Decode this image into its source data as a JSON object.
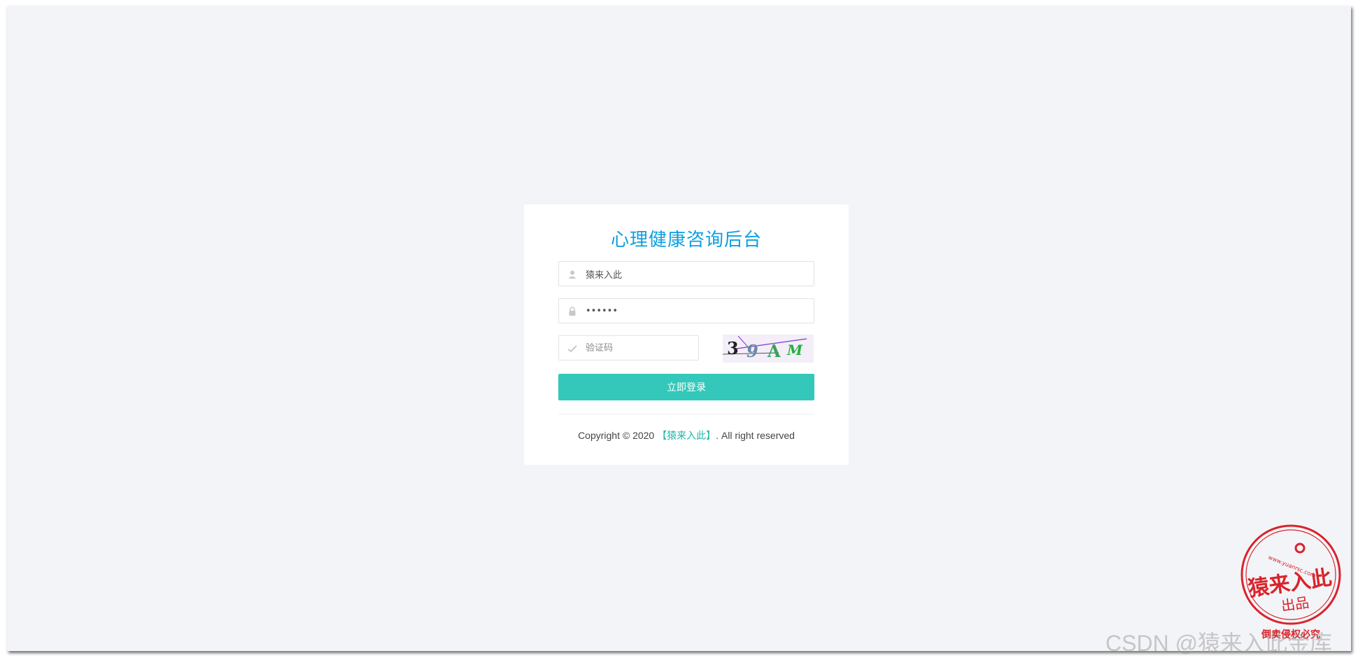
{
  "login": {
    "title": "心理健康咨询后台",
    "username_value": "猿来入此",
    "password_value": "••••••",
    "captcha_placeholder": "验证码",
    "captcha_chars": [
      "3",
      "9",
      "A",
      "M"
    ],
    "submit_label": "立即登录"
  },
  "footer": {
    "copyright_prefix": "Copyright © 2020 ",
    "brand_link": "【猿来入此】",
    "copyright_suffix": ". All right reserved"
  },
  "watermark": {
    "text": "CSDN @猿来入此金库"
  },
  "seal": {
    "main_text": "猿来入此",
    "sub_text": "出品",
    "url_text": "www.yuanrsc.com",
    "bottom_text": "倒卖侵权必究"
  },
  "colors": {
    "title": "#0d9fe0",
    "button": "#33c8b9",
    "link": "#1cb7a8",
    "seal": "#d9232a"
  }
}
